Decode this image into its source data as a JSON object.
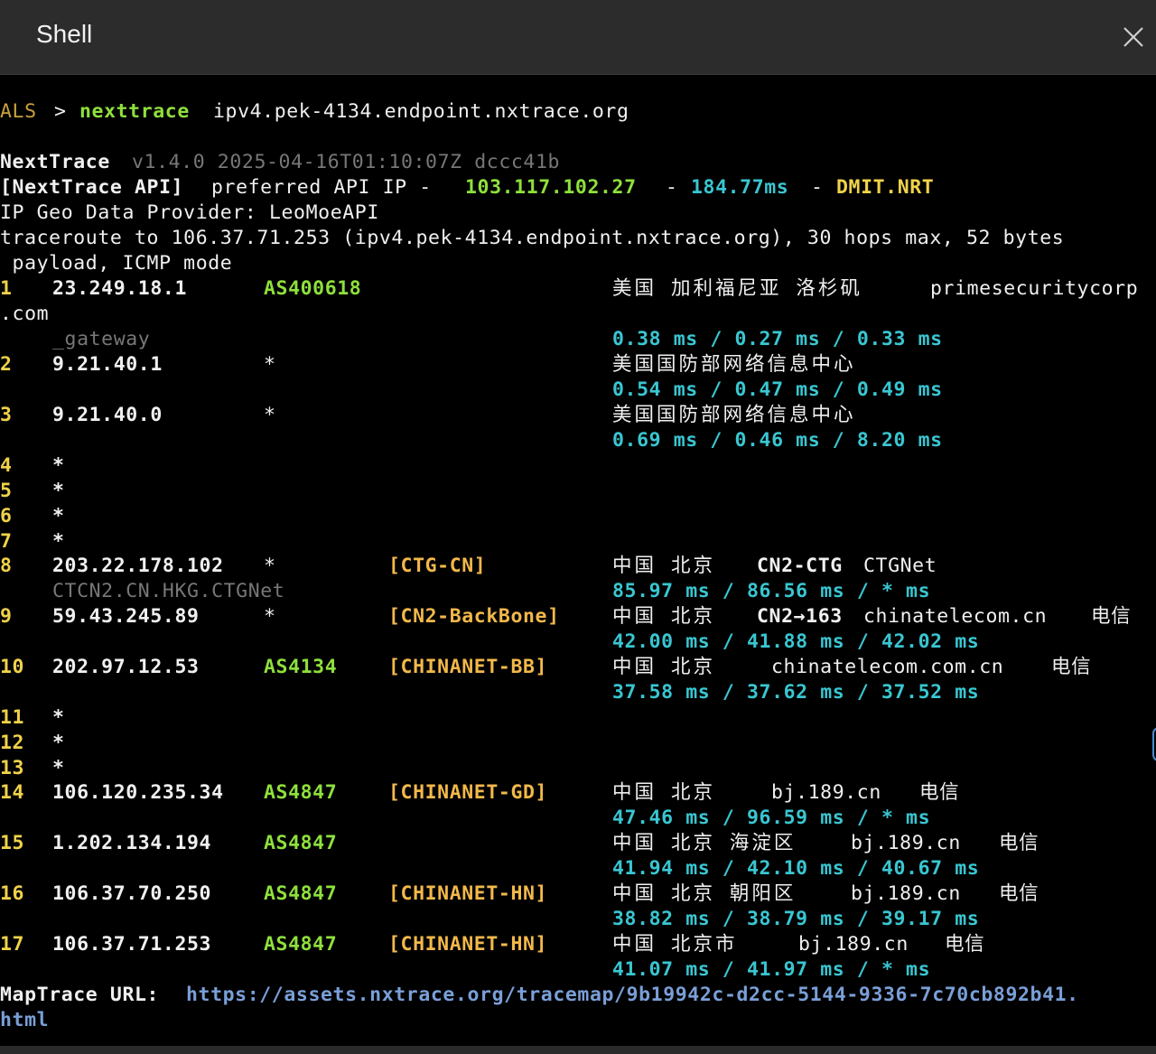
{
  "window": {
    "title": "Shell",
    "close_icon": "close-icon",
    "accent_colors": {
      "prompt": "#c9a23a",
      "green": "#8ee03c",
      "cyan": "#39c6d1",
      "yellow": "#f0d24a",
      "orange": "#f2b84a",
      "link": "#7a9fd8"
    }
  },
  "terminal": {
    "prompt": "ALS",
    "prompt_sep": ">",
    "command": "nexttrace",
    "command_arg": "ipv4.pek-4134.endpoint.nxtrace.org",
    "version_name": "NextTrace",
    "version_info": "v1.4.0 2025-04-16T01:10:07Z dccc41b",
    "api_label": "[NextTrace API]",
    "api_text": "preferred API IP -",
    "api_ip": "103.117.102.27",
    "api_dash1": "-",
    "api_latency": "184.77ms",
    "api_dash2": "-",
    "api_node": "DMIT.NRT",
    "geo_provider": "IP Geo Data Provider: LeoMoeAPI",
    "traceroute_line1": "traceroute to 106.37.71.253 (ipv4.pek-4134.endpoint.nxtrace.org), 30 hops max, 52 bytes",
    "traceroute_line2": " payload, ICMP mode",
    "hops": [
      {
        "n": "1",
        "ip": "23.249.18.1",
        "as": "AS400618",
        "geo": "美国 加利福尼亚 洛杉矶",
        "domain": "primesecuritycorp",
        "domain_cont": ".com",
        "host": "_gateway",
        "rtt": "0.38 ms / 0.27 ms / 0.33 ms"
      },
      {
        "n": "2",
        "ip": "9.21.40.1",
        "as": "*",
        "geo": "美国国防部网络信息中心",
        "rtt": "0.54 ms / 0.47 ms / 0.49 ms"
      },
      {
        "n": "3",
        "ip": "9.21.40.0",
        "as": "*",
        "geo": "美国国防部网络信息中心",
        "rtt": "0.69 ms / 0.46 ms / 8.20 ms"
      },
      {
        "n": "4",
        "ip": "*"
      },
      {
        "n": "5",
        "ip": "*"
      },
      {
        "n": "6",
        "ip": "*"
      },
      {
        "n": "7",
        "ip": "*"
      },
      {
        "n": "8",
        "ip": "203.22.178.102",
        "as": "*",
        "tag": "[CTG-CN]",
        "geo": "中国 北京",
        "net": "CN2-CTG",
        "domain": "CTGNet",
        "host": "CTCN2.CN.HKG.CTGNet",
        "rtt": "85.97 ms / 86.56 ms / * ms"
      },
      {
        "n": "9",
        "ip": "59.43.245.89",
        "as": "*",
        "tag": "[CN2-BackBone]",
        "geo": "中国 北京",
        "net": "CN2→163",
        "domain": "chinatelecom.cn",
        "isp": "电信",
        "rtt": "42.00 ms / 41.88 ms / 42.02 ms"
      },
      {
        "n": "10",
        "ip": "202.97.12.53",
        "as": "AS4134",
        "tag": "[CHINANET-BB]",
        "geo": "中国 北京",
        "domain": "chinatelecom.com.cn",
        "isp": "电信",
        "rtt": "37.58 ms / 37.62 ms / 37.52 ms"
      },
      {
        "n": "11",
        "ip": "*"
      },
      {
        "n": "12",
        "ip": "*"
      },
      {
        "n": "13",
        "ip": "*"
      },
      {
        "n": "14",
        "ip": "106.120.235.34",
        "as": "AS4847",
        "tag": "[CHINANET-GD]",
        "geo": "中国 北京",
        "domain": "bj.189.cn",
        "isp": "电信",
        "rtt": "47.46 ms / 96.59 ms / * ms"
      },
      {
        "n": "15",
        "ip": "1.202.134.194",
        "as": "AS4847",
        "geo": "中国 北京 海淀区",
        "domain": "bj.189.cn",
        "isp": "电信",
        "rtt": "41.94 ms / 42.10 ms / 40.67 ms"
      },
      {
        "n": "16",
        "ip": "106.37.70.250",
        "as": "AS4847",
        "tag": "[CHINANET-HN]",
        "geo": "中国 北京 朝阳区",
        "domain": "bj.189.cn",
        "isp": "电信",
        "rtt": "38.82 ms / 38.79 ms / 39.17 ms"
      },
      {
        "n": "17",
        "ip": "106.37.71.253",
        "as": "AS4847",
        "tag": "[CHINANET-HN]",
        "geo": "中国 北京市",
        "domain": "bj.189.cn",
        "isp": "电信",
        "rtt": "41.07 ms / 41.97 ms / * ms"
      }
    ],
    "maptrace_label": "MapTrace URL:",
    "maptrace_url": "https://assets.nxtrace.org/tracemap/9b19942c-d2cc-5144-9336-7c70cb892b41.",
    "maptrace_url_cont": "html"
  }
}
